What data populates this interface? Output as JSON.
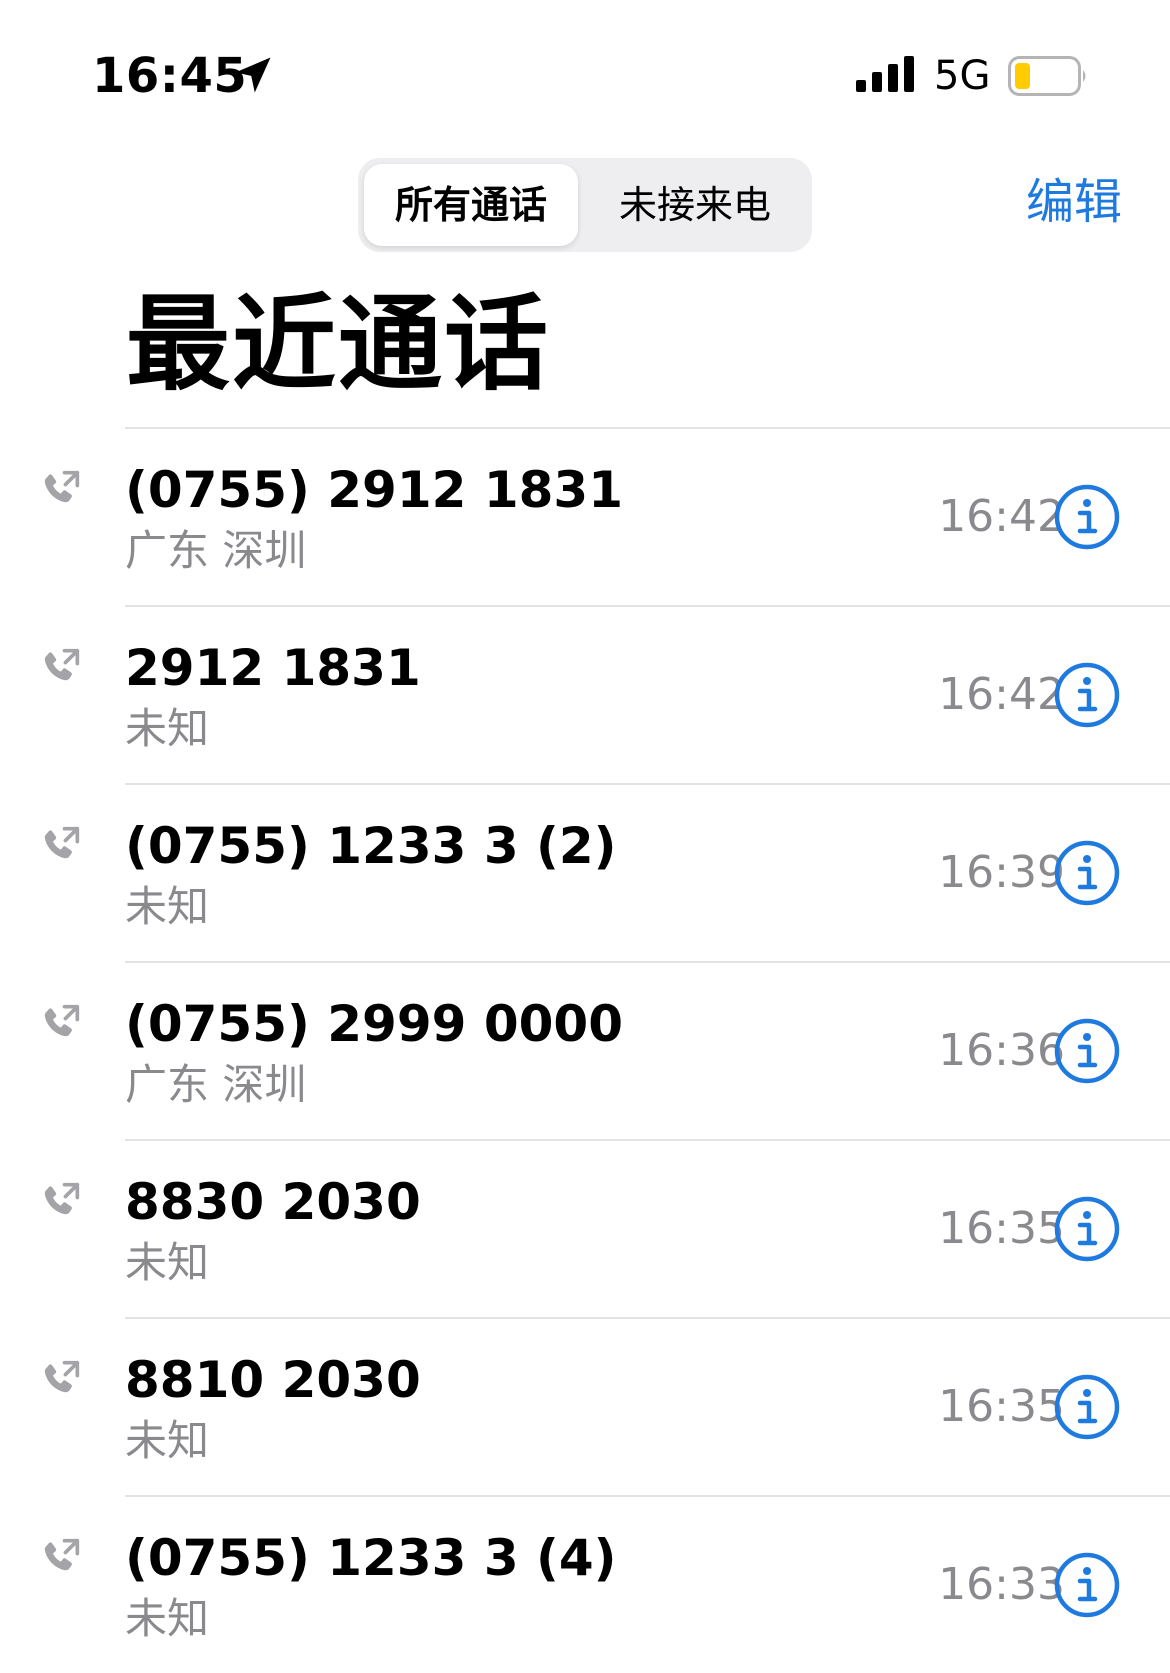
{
  "status_bar": {
    "time": "16:45",
    "network": "5G",
    "icons": [
      "location-arrow-icon",
      "cellular-signal-icon",
      "battery-icon"
    ],
    "battery_fill_fraction": 0.25,
    "battery_color": "#ffcc00"
  },
  "header": {
    "tabs": [
      {
        "label": "所有通话",
        "active": true
      },
      {
        "label": "未接来电",
        "active": false
      }
    ],
    "edit_label": "编辑",
    "title": "最近通话"
  },
  "colors": {
    "accent": "#1f7ae0",
    "secondary_text": "#8a8a8e",
    "separator": "#e3e3e6"
  },
  "calls": [
    {
      "number": "(0755) 2912 1831",
      "location": "广东 深圳",
      "time": "16:42",
      "icon": "outgoing-call-icon"
    },
    {
      "number": "2912 1831",
      "location": "未知",
      "time": "16:42",
      "icon": "outgoing-call-icon"
    },
    {
      "number": "(0755) 1233 3 (2)",
      "location": "未知",
      "time": "16:39",
      "icon": "outgoing-call-icon"
    },
    {
      "number": "(0755) 2999 0000",
      "location": "广东 深圳",
      "time": "16:36",
      "icon": "outgoing-call-icon"
    },
    {
      "number": "8830 2030",
      "location": "未知",
      "time": "16:35",
      "icon": "outgoing-call-icon"
    },
    {
      "number": "8810 2030",
      "location": "未知",
      "time": "16:35",
      "icon": "outgoing-call-icon"
    },
    {
      "number": "(0755) 1233 3 (4)",
      "location": "未知",
      "time": "16:33",
      "icon": "outgoing-call-icon"
    }
  ]
}
